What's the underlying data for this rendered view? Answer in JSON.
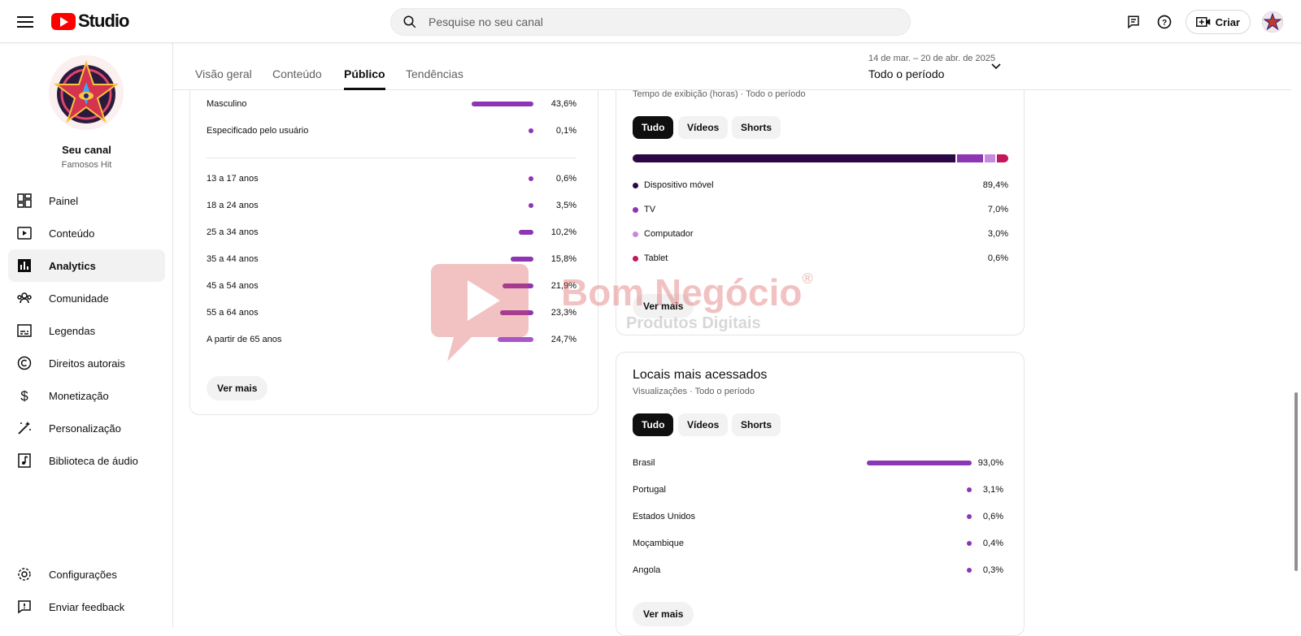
{
  "header": {
    "logo_text": "Studio",
    "search_placeholder": "Pesquise no seu canal",
    "create_label": "Criar"
  },
  "channel": {
    "name": "Seu canal",
    "handle": "Famosos Hit"
  },
  "sidebar": {
    "items": [
      {
        "label": "Painel",
        "icon": "dashboard-icon"
      },
      {
        "label": "Conteúdo",
        "icon": "content-icon"
      },
      {
        "label": "Analytics",
        "icon": "analytics-icon",
        "active": true
      },
      {
        "label": "Comunidade",
        "icon": "community-icon"
      },
      {
        "label": "Legendas",
        "icon": "subtitles-icon"
      },
      {
        "label": "Direitos autorais",
        "icon": "copyright-icon"
      },
      {
        "label": "Monetização",
        "icon": "monetization-icon"
      },
      {
        "label": "Personalização",
        "icon": "customization-icon"
      },
      {
        "label": "Biblioteca de áudio",
        "icon": "audio-library-icon"
      }
    ],
    "bottom_items": [
      {
        "label": "Configurações",
        "icon": "gear-icon"
      },
      {
        "label": "Enviar feedback",
        "icon": "feedback-icon"
      }
    ]
  },
  "tabs": [
    {
      "label": "Visão geral"
    },
    {
      "label": "Conteúdo"
    },
    {
      "label": "Público",
      "active": true
    },
    {
      "label": "Tendências"
    }
  ],
  "date_range": {
    "range": "14 de mar. – 20 de abr. de 2025",
    "label": "Todo o período"
  },
  "demographics": {
    "gender": [
      {
        "label": "Masculino",
        "value": "43,6%",
        "pct": 43.6
      },
      {
        "label": "Especificado pelo usuário",
        "value": "0,1%",
        "pct": 0.1
      }
    ],
    "age": [
      {
        "label": "13 a 17 anos",
        "value": "0,6%",
        "pct": 0.6
      },
      {
        "label": "18 a 24 anos",
        "value": "3,5%",
        "pct": 3.5
      },
      {
        "label": "25 a 34 anos",
        "value": "10,2%",
        "pct": 10.2
      },
      {
        "label": "35 a 44 anos",
        "value": "15,8%",
        "pct": 15.8
      },
      {
        "label": "45 a 54 anos",
        "value": "21,9%",
        "pct": 21.9
      },
      {
        "label": "55 a 64 anos",
        "value": "23,3%",
        "pct": 23.3
      },
      {
        "label": "A partir de 65 anos",
        "value": "24,7%",
        "pct": 24.7
      }
    ],
    "more_label": "Ver mais"
  },
  "devices": {
    "subtitle": "Tempo de exibição (horas) · Todo o período",
    "chips": [
      "Tudo",
      "Vídeos",
      "Shorts"
    ],
    "items": [
      {
        "label": "Dispositivo móvel",
        "value": "89,4%",
        "pct": 89.4,
        "color": "#2a0845"
      },
      {
        "label": "TV",
        "value": "7,0%",
        "pct": 7.0,
        "color": "#8d35b3"
      },
      {
        "label": "Computador",
        "value": "3,0%",
        "pct": 3.0,
        "color": "#c58be0"
      },
      {
        "label": "Tablet",
        "value": "0,6%",
        "pct": 0.6,
        "color": "#c2185b"
      }
    ],
    "more_label": "Ver mais"
  },
  "locations": {
    "title": "Locais mais acessados",
    "subtitle": "Visualizações · Todo o período",
    "chips": [
      "Tudo",
      "Vídeos",
      "Shorts"
    ],
    "items": [
      {
        "label": "Brasil",
        "value": "93,0%",
        "pct": 93.0
      },
      {
        "label": "Portugal",
        "value": "3,1%",
        "pct": 3.1
      },
      {
        "label": "Estados Unidos",
        "value": "0,6%",
        "pct": 0.6
      },
      {
        "label": "Moçambique",
        "value": "0,4%",
        "pct": 0.4
      },
      {
        "label": "Angola",
        "value": "0,3%",
        "pct": 0.3
      }
    ],
    "more_label": "Ver mais"
  },
  "watermark": {
    "line1": "Bom Negócio",
    "line2": "Produtos Digitais",
    "mark": "®"
  },
  "colors": {
    "accent": "#8d35b3",
    "brand": "#ff0000"
  }
}
